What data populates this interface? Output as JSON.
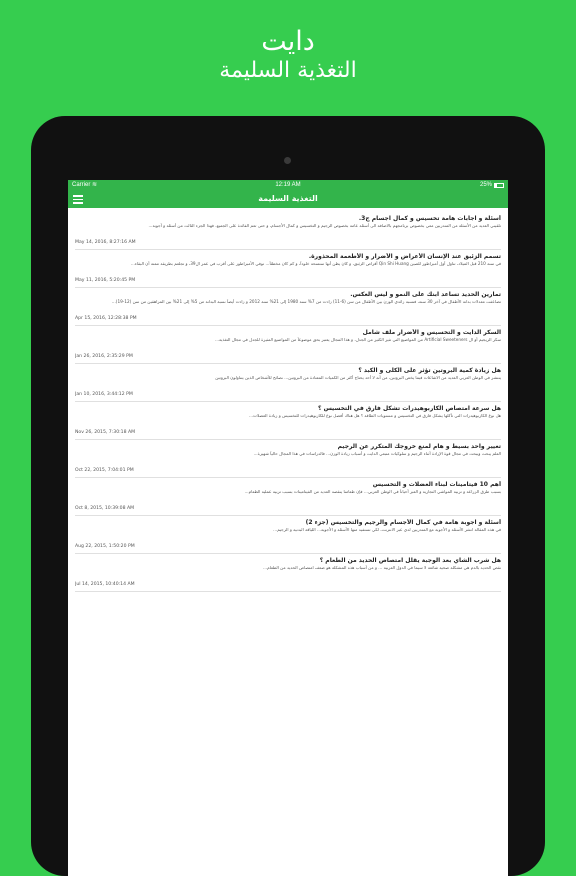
{
  "hero": {
    "title": "دايت",
    "subtitle": "التغذية السليمة"
  },
  "status": {
    "carrier": "Carrier",
    "time": "12:19 AM",
    "battery": "25%",
    "battery_level": 0.25
  },
  "nav": {
    "title": "التغذية السليمة"
  },
  "articles": [
    {
      "title": "أسئلة و اجابات هامة تخسيس و كمال اجسام ج3.",
      "excerpt": "تلقيني العديد من الأسئلة من المتدربين معي بخصوص برنامجهم بالاضافة الى أسئلة عامة بخصوص الرجيم و التخسيس و كمال الأجسام، و حتى تعم الفائدة على الجميع، فهذا الجزء الثالث من أسئلة و أجوبة...",
      "date": "May 14, 2016, 8:27:16 AM"
    },
    {
      "title": "تسمم الزئبق عند الإنسان الأعراض و الأضرار و الأطعمة المحذورة.",
      "excerpt": "في سنة 210 قبل الميلاد، تناول أول أمبراطور للصين Qin Shi Huang أقراص الزئبق، و كان يظن أنها ستمنحه خلوداً، و كم كان مخطئاً... توفي الأمبراطور على أقرب في عمر ال39، و تجلعم بطريقة ممتة أن البقاء...",
      "date": "May 11, 2016, 5:20:45 PM"
    },
    {
      "title": "تمارين الحديد تساعد ابنك على النمو و ليس العكس.",
      "excerpt": "تضاعفت معدلات بدانة الأطفال في آخر 30 سنة، فنسبة زائدي الوزن بين الأطفال من سن (6-11) زادت من 7% سنة 1980 إلى 21% سنة 2012 و زادت أيضاً نسبة البدانة من 5% إلى 21% بين المراهقين من سن (12-19)...",
      "date": "Apr 15, 2016, 12:28:38 PM"
    },
    {
      "title": "السكر الدايت و التخسيس و الأضرار ملف شامل",
      "excerpt": "سكر الريجيم أو ال Artificial Sweeteners من المواضيع التي تثير الكثير من الجدل، و هذا المجال يعتبر بحق موضوعاً من المواضيع المثيرة للجدل في مجال التغذية...",
      "date": "Jan 26, 2016, 2:35:29 PM"
    },
    {
      "title": "هل زيادة كمية البروتين تؤثر على الكلى و الكبد ؟",
      "excerpt": "ينتشر في الوطن العربي العديد من الاشاعات فيما يخص البروتين، من أنه لا أحد يحتاج أكثر من الكميات المعتادة من البروتين... نصائح للأشخاص الذين يتناولون البروتين",
      "date": "Jan 10, 2016, 3:44:12 PM"
    },
    {
      "title": "هل سرعة امتصاص الكاربوهيدرات تشكل فارق في التخسيس ؟",
      "excerpt": "هل نوع الكاربوهيدرات التي تأكلها يشكل فارق في التخسيس و مستويات الطاقة ؟ هل هناك أفضل نوع للكاربوهيدرات للتخسيس و زيادة العضلات...",
      "date": "Nov 26, 2015, 7:30:18 AM"
    },
    {
      "title": "تغيير واحد بسيط و هام لمنع خروجك المتكرر عن الرجيم",
      "excerpt": "العلم يبحث ويبحث في مجال قوة الإرادة أثناء الرجيم و سلوكيات متبعي الدايت و أسباب زيادة الوزن... فالدراسات في هذا المجال حالياً شهيرة...",
      "date": "Oct 22, 2015, 7:04:01 PM"
    },
    {
      "title": "أهم 10 فيتامينات لبناء العضلات و التخسيس",
      "excerpt": "بسبب طرق الزراعة و تربية المواشي التجارية و العبر أحياناً في الوطن العربي... فإن طعامنا ينقصه العديد من الفيتامينات بسبب تربية عملية الطعام...",
      "date": "Oct 8, 2015, 10:39:08 AM"
    },
    {
      "title": "أسئلة و اجوبة هامة في كمال الأجسام والرجيم والتخسيس (جزء 2)",
      "excerpt": "في هذه المقالة انشر الأسئلة و الأجوبة مع المتدربين لدي عبر الانترنت، لكي تستفيد منها الأسئلة و الأجوبة... اللياقة البدنية و الرجيم...",
      "date": "Aug 22, 2015, 1:50:20 PM"
    },
    {
      "title": "هل شرب الشاي بعد الوجبة يقلل امتصاص الحديد من الطعام ؟",
      "excerpt": "نقص الحديد بالدم هي مشكلة صحية شائعة لا سيما في الدول العربية ... و من أسباب هذه المشكلة هو ضعف امتصاص الحديد من الطعام...",
      "date": "Jul 14, 2015, 10:40:14 AM"
    }
  ]
}
